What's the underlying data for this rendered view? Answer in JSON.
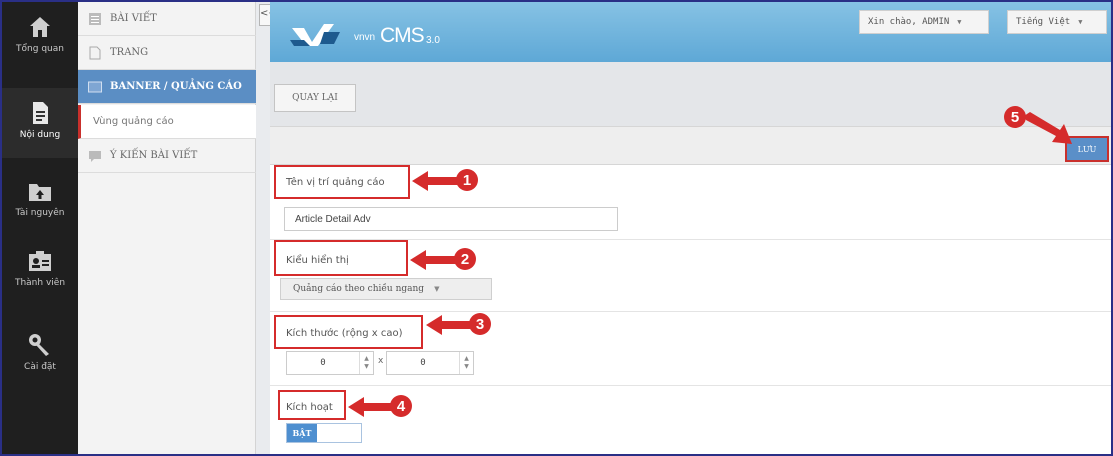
{
  "rail": {
    "items": [
      {
        "label": "Tổng quan",
        "icon": "home-icon"
      },
      {
        "label": "Nội dung",
        "icon": "document-icon"
      },
      {
        "label": "Tài nguyên",
        "icon": "folder-icon"
      },
      {
        "label": "Thành viên",
        "icon": "user-card-icon"
      },
      {
        "label": "Cài đặt",
        "icon": "wrench-icon"
      }
    ]
  },
  "nav": {
    "items": [
      {
        "label": "BÀI VIẾT",
        "icon": "list-icon"
      },
      {
        "label": "TRANG",
        "icon": "page-icon"
      },
      {
        "label": "BANNER / QUẢNG CÁO",
        "icon": "banner-icon"
      },
      {
        "label": "Vùng quảng cáo"
      },
      {
        "label": "Ý KIẾN BÀI VIẾT",
        "icon": "comment-icon"
      }
    ],
    "collapse_label": "<<"
  },
  "header": {
    "logo_word": "vnvn",
    "logo_text": "CMS",
    "logo_version": "3.0",
    "greeting": "Xin chào, ADMIN",
    "language": "Tiếng Việt"
  },
  "toolbar": {
    "back_label": "QUAY LẠI"
  },
  "form": {
    "save_label": "LƯU",
    "position_name_label": "Tên vị trí quảng cáo",
    "position_name_value": "Article Detail Adv",
    "display_type_label": "Kiểu hiển thị",
    "display_type_value": "Quảng cáo theo chiều ngang",
    "size_label": "Kích thước (rộng x cao)",
    "width_value": "0",
    "height_value": "0",
    "size_separator": "x",
    "active_label": "Kích hoạt",
    "active_toggle_label": "BẬT"
  },
  "annotations": [
    "1",
    "2",
    "3",
    "4",
    "5"
  ],
  "colors": {
    "accent": "#5b8ec4",
    "header": "#6db3dd",
    "annotation_red": "#d52b2b",
    "rail_bg": "#1f1f1f"
  }
}
